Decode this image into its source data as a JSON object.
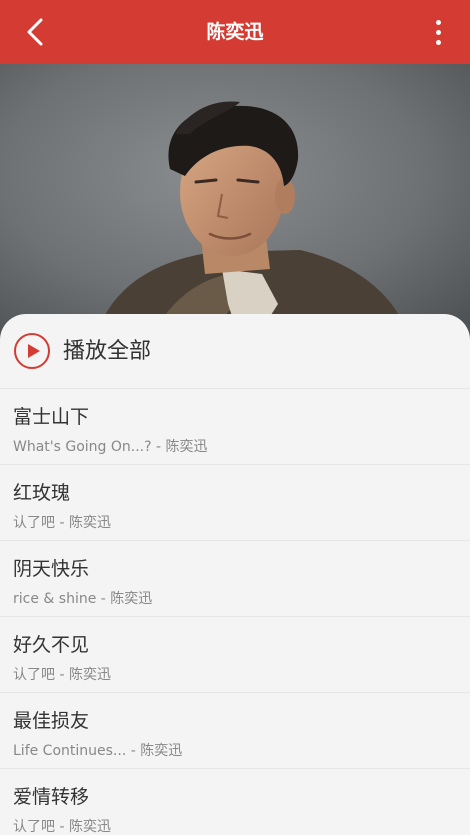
{
  "header": {
    "title": "陈奕迅",
    "back_icon": "chevron-left-icon",
    "more_icon": "more-vertical-icon",
    "bar_color": "#d43c33"
  },
  "hero": {
    "image": "artist-photo"
  },
  "play_all": {
    "label": "播放全部",
    "icon": "play-circle-icon",
    "accent_color": "#d43c33"
  },
  "songs": [
    {
      "title": "富士山下",
      "album": "What's Going On...?",
      "artist": "陈奕迅"
    },
    {
      "title": "红玫瑰",
      "album": "认了吧",
      "artist": "陈奕迅"
    },
    {
      "title": "阴天快乐",
      "album": "rice & shine",
      "artist": "陈奕迅"
    },
    {
      "title": "好久不见",
      "album": "认了吧",
      "artist": "陈奕迅"
    },
    {
      "title": "最佳损友",
      "album": "Life Continues...",
      "artist": "陈奕迅"
    },
    {
      "title": "爱情转移",
      "album": "认了吧",
      "artist": "陈奕迅"
    }
  ],
  "subtitle_separator": " - "
}
